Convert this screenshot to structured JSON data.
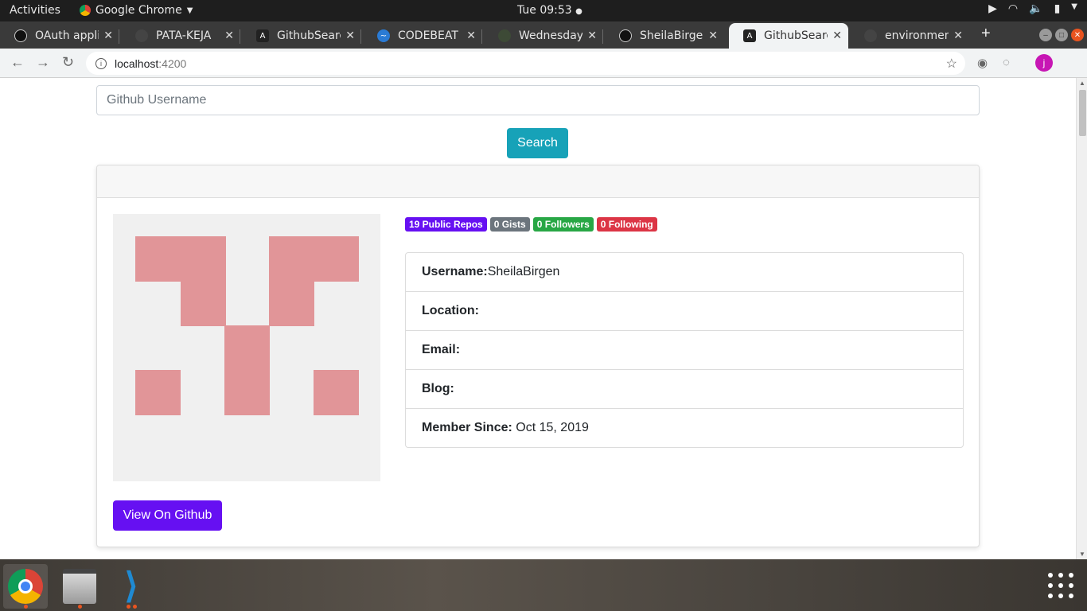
{
  "system": {
    "activities": "Activities",
    "app_name": "Google Chrome",
    "clock": "Tue 09:53"
  },
  "tabs": [
    {
      "title": "OAuth applic",
      "favicon": "github-icon"
    },
    {
      "title": "PATA-KEJA",
      "favicon": "blank-icon"
    },
    {
      "title": "GithubSearch",
      "favicon": "angular-icon"
    },
    {
      "title": "CODEBEAT -",
      "favicon": "codebeat-icon"
    },
    {
      "title": "Wednesday:",
      "favicon": "leaf-icon"
    },
    {
      "title": "SheilaBirgen",
      "favicon": "github-icon"
    },
    {
      "title": "GithubSearch",
      "favicon": "angular-icon",
      "active": true
    },
    {
      "title": "environment",
      "favicon": "blank-icon"
    }
  ],
  "address_bar": {
    "host": "localhost",
    "port": ":4200",
    "profile_initial": "j"
  },
  "search": {
    "placeholder": "Github Username",
    "button_label": "Search"
  },
  "profile": {
    "badges": {
      "repos": "19 Public Repos",
      "gists": "0 Gists",
      "followers": "0 Followers",
      "following": "0 Following"
    },
    "fields": {
      "username_label": "Username:",
      "username_value": "SheilaBirgen",
      "location_label": "Location:",
      "email_label": "Email:",
      "blog_label": "Blog:",
      "member_since_label": "Member Since:",
      "member_since_value": "Oct 15, 2019"
    },
    "view_button": "View On Github"
  },
  "colors": {
    "badge_repos": "#6610f2",
    "badge_gists": "#6c757d",
    "badge_followers": "#28a745",
    "badge_following": "#dc3545",
    "search_button": "#17a2b8",
    "view_button": "#6610f2",
    "identicon": "#e19598"
  }
}
